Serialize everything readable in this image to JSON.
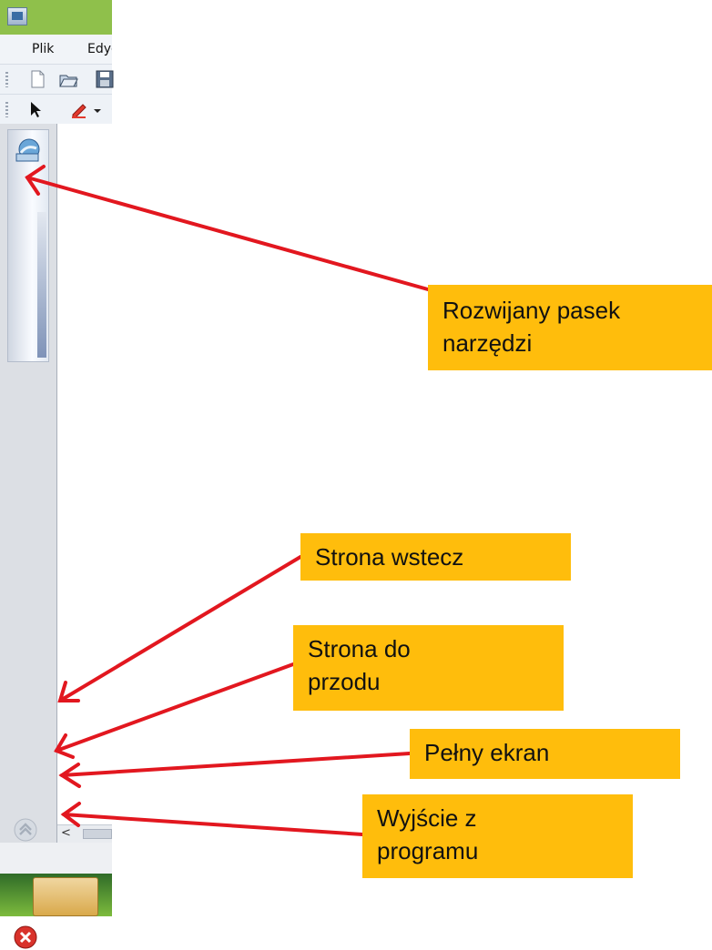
{
  "menu": {
    "file": "Plik",
    "edit": "Edycja"
  },
  "toolbar1": {
    "icons": [
      "new-page-icon",
      "open-folder-icon",
      "save-icon"
    ]
  },
  "toolbar2": {
    "icons": [
      "pointer-arrow-icon",
      "pen-icon",
      "dropdown-caret-icon"
    ]
  },
  "sidebar": {
    "drawer_icon": "gallery-icon",
    "nav_buttons": [
      "page-back-button",
      "page-forward-button",
      "fullscreen-button",
      "exit-button"
    ]
  },
  "scrollbar": {
    "left_arrow": "<"
  },
  "annotations": {
    "dropdown_toolbar": {
      "line1": "Rozwijany pasek",
      "line2": "narzędzi"
    },
    "page_back": {
      "line1": "Strona wstecz"
    },
    "page_forward": {
      "line1": "Strona do",
      "line2": "przodu"
    },
    "fullscreen": {
      "line1": "Pełny ekran"
    },
    "exit": {
      "line1": "Wyjście z",
      "line2": "programu"
    }
  },
  "colors": {
    "callout_bg": "#ffbd0c",
    "arrow": "#e2171f",
    "titlebar": "#8fc04b"
  }
}
